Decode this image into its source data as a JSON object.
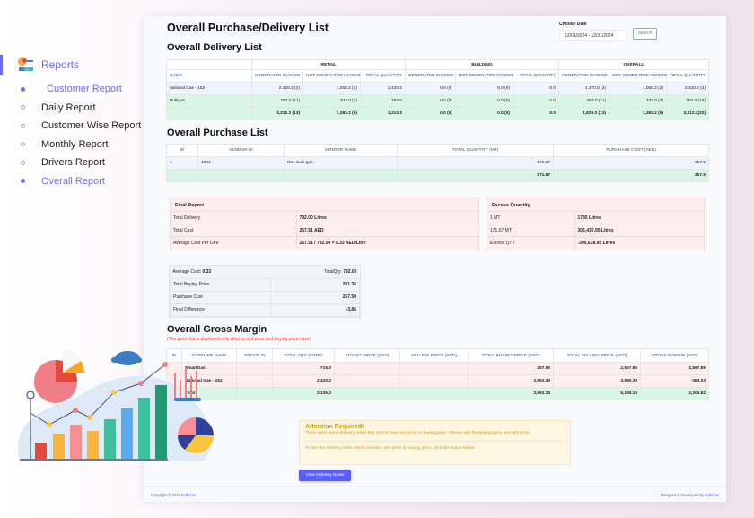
{
  "sidebar": {
    "title": "Reports",
    "items": [
      {
        "label": "Customer Report",
        "active": true
      },
      {
        "label": "Daily Report",
        "active": false
      },
      {
        "label": "Customer Wise Report",
        "active": false
      },
      {
        "label": "Monthly Report",
        "active": false
      },
      {
        "label": "Drivers Report",
        "active": false
      },
      {
        "label": "Overall Report",
        "active": true
      }
    ]
  },
  "header": {
    "title": "Overall Purchase/Delivery List",
    "date_label": "Choose Date",
    "date_value": "12/01/2024 - 12/31/2024",
    "search_label": "Search"
  },
  "delivery": {
    "title": "Overall Delivery List",
    "groups": [
      "RETAIL",
      "BUILDING",
      "OVERALL"
    ],
    "columns": [
      "NAME",
      "GENERATED INVOICE",
      "NOT GENERATED INVOICE",
      "TOTAL QUANTITY",
      "GENERATED INVOICE",
      "NOT GENERATED INVOICE",
      "TOTAL QUANTITY",
      "GENERATED INVOICE",
      "NOT GENERATED INVOICE",
      "TOTAL QUANTITY"
    ],
    "rows": [
      [
        "national Gas - 152",
        "2,420.2 (2)",
        "1,050.2 (2)",
        "2,420.2",
        "0.0 (0)",
        "0.0 (0)",
        "0.0",
        "1,370.0 (2)",
        "1,050.2 (2)",
        "2,420.2 (4)"
      ],
      [
        "Bulkgas",
        "792.0 (11)",
        "333.0 (7)",
        "792.0",
        "0.0 (0)",
        "0.0 (0)",
        "0.0",
        "459.0 (11)",
        "333.0 (7)",
        "792.0 (18)"
      ],
      [
        "",
        "3,212.2 (13)",
        "1,383.2 (9)",
        "3,212.2",
        "0.0 (0)",
        "0.0 (0)",
        "0.0",
        "1,829.0 (13)",
        "1,383.2 (9)",
        "3,212.2(22)"
      ]
    ]
  },
  "purchase": {
    "title": "Overall Purchase List",
    "columns": [
      "ID",
      "VENDOR ID",
      "VENDOR NAME",
      "TOTAL QUANTITY (MT)",
      "PURCHASE COST (AED)"
    ],
    "rows": [
      [
        "1",
        "1001",
        "No1 Bulk gas",
        "171.67",
        "257.5"
      ],
      [
        "",
        "",
        "",
        "171.67",
        "257.5"
      ]
    ]
  },
  "final_report": {
    "title": "Final Report",
    "rows": [
      [
        "Total Delivery",
        "792.00 Litres"
      ],
      [
        "Total Cost",
        "257.51 AED"
      ],
      [
        "Average Cost Per Litre",
        "257.51 / 792.00 = 0.33 AED/Litre"
      ]
    ]
  },
  "excess": {
    "title": "Excess Quantity",
    "rows": [
      [
        "1 MT",
        "1785 Litres"
      ],
      [
        "171.67 MT",
        "306,430.95 Litres"
      ],
      [
        "Excess QTY",
        "-305,638.95 Litres"
      ]
    ]
  },
  "summary": {
    "avg_cost_label": "Average Cost:",
    "avg_cost_value": "0.33",
    "total_qty_label": "TotalQty:",
    "total_qty_value": "792.00",
    "rows": [
      [
        "Total Buying Price",
        "261.36"
      ],
      [
        "Purchase Cost",
        "257.50"
      ],
      [
        "Final Difference",
        "-3.86"
      ]
    ]
  },
  "gross_margin": {
    "title": "Overall Gross Margin",
    "note": "(The given list is displayed only when a unit price and buying price have)",
    "columns": [
      "ID",
      "SUPPLIER NAME",
      "GROUP ID",
      "TOTAL QTY (LITRE)",
      "BUYING PRICE (AED)",
      "SELLING PRICE (AED)",
      "TOTAL BUYING PRICE (AED)",
      "TOTAL SELLING PRICE (AED)",
      "GROSS MARGIN (AED)"
    ],
    "rows": [
      [
        "",
        "SmartGas",
        "",
        "715.0",
        "",
        "",
        "257.50",
        "2,567.85",
        "2,567.85"
      ],
      [
        "",
        "National Gas - 152",
        "",
        "2,420.2",
        "",
        "",
        "3,993.33",
        "3,630.30",
        "-363.03"
      ],
      [
        "",
        "Total",
        "",
        "3,135.2",
        "",
        "",
        "3,993.33",
        "6,198.15",
        "2,204.82"
      ]
    ]
  },
  "alert": {
    "title": "Attention Required!",
    "message": "There were some delivery notes that do not have unit price or buying price. Please add the buying price and unit price.",
    "hint": "To see the delivery notes which not have unit price or buying price, click the button below."
  },
  "view_button": "View Delivery Notes",
  "footer": {
    "copyright": "Copyright © 2022 ",
    "brand": "BulkGas.",
    "designed": "Designed & Developed by ",
    "designed_brand": "BulkGas"
  },
  "colors": {
    "accent": "#6b6cf6",
    "button": "#5b5ff5",
    "success": "#2cab5c",
    "danger": "#e33333",
    "warning": "#d39c0e"
  }
}
